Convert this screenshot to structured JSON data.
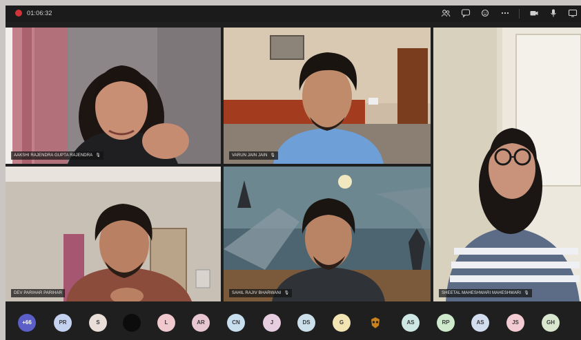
{
  "call": {
    "timer": "01:06:32"
  },
  "toolbar": {
    "icons": [
      "participants-icon",
      "chat-icon",
      "reactions-icon",
      "more-icon",
      "camera-icon",
      "mic-icon",
      "share-icon"
    ]
  },
  "participants": [
    {
      "name": "AAKSHI RAJENDRA GUPTA RAJENDRA"
    },
    {
      "name": "VARUN JAIN JAIN"
    },
    {
      "name": "SHEETAL MAHESHWARI MAHESHWARI"
    },
    {
      "name": "DEV PARIHAR PARIHAR"
    },
    {
      "name": "SAHIL RAJIV BHARWANI"
    }
  ],
  "roster": {
    "overflow": "+66",
    "items": [
      {
        "initials": "PR",
        "color": "#c4d2ef"
      },
      {
        "initials": "S",
        "color": "#eaded8"
      },
      {
        "initials": "",
        "color": "#0c0c0c"
      },
      {
        "initials": "L",
        "color": "#f0c9cf"
      },
      {
        "initials": "AR",
        "color": "#e8c6d2"
      },
      {
        "initials": "CN",
        "color": "#c8dff0"
      },
      {
        "initials": "J",
        "color": "#e6cde0"
      },
      {
        "initials": "DS",
        "color": "#cce0ec"
      },
      {
        "initials": "G",
        "color": "#f3e4b4"
      },
      {
        "initials": "",
        "color": "#1f1f1f"
      },
      {
        "initials": "AS",
        "color": "#cde8e4"
      },
      {
        "initials": "RP",
        "color": "#cfe9cd"
      },
      {
        "initials": "AS",
        "color": "#d2ddf0"
      },
      {
        "initials": "JS",
        "color": "#f3cbd2"
      },
      {
        "initials": "GH",
        "color": "#dae7cf"
      }
    ]
  }
}
